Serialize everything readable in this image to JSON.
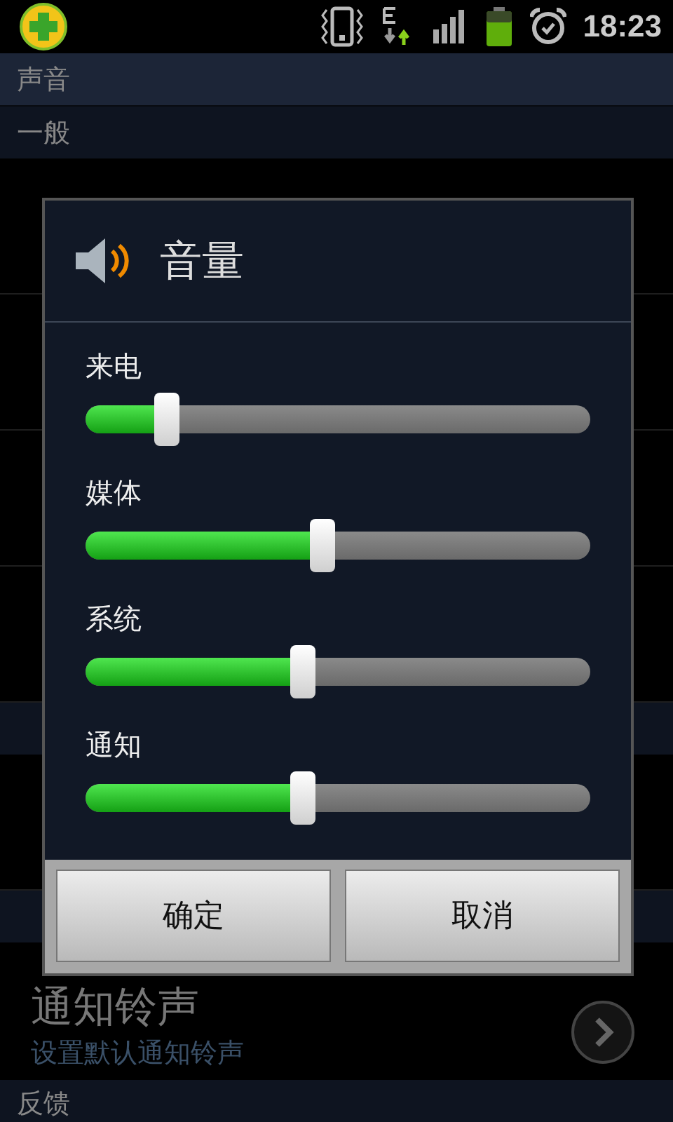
{
  "status_bar": {
    "time": "18:23"
  },
  "screen": {
    "title": "声音",
    "section_header": "一般",
    "notification_item": {
      "title": "通知铃声",
      "summary": "设置默认通知铃声"
    },
    "bottom_header": "反馈"
  },
  "dialog": {
    "title": "音量",
    "sliders": [
      {
        "label": "来电",
        "level": 0.16
      },
      {
        "label": "媒体",
        "level": 0.47
      },
      {
        "label": "系统",
        "level": 0.43
      },
      {
        "label": "通知",
        "level": 0.43
      }
    ],
    "buttons": [
      "确定",
      "取消"
    ]
  }
}
